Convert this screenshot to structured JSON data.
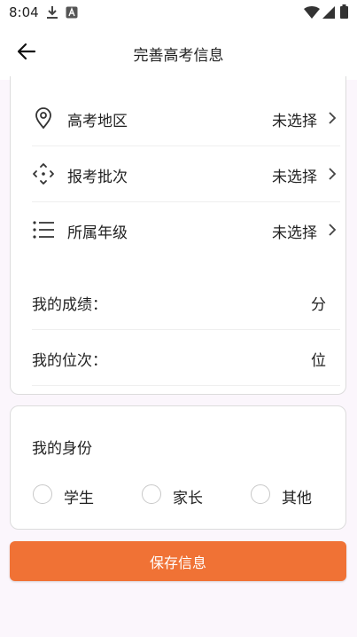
{
  "status_bar": {
    "time": "8:04",
    "left_icons": [
      "download-icon",
      "a-box-icon"
    ],
    "right_icons": [
      "wifi-icon",
      "signal-icon",
      "battery-icon"
    ]
  },
  "header": {
    "title": "完善高考信息",
    "back_icon": "arrow-left-icon"
  },
  "form": {
    "select_rows": [
      {
        "icon": "location-pin-icon",
        "label": "高考地区",
        "value": "未选择"
      },
      {
        "icon": "crosshair-dashed-icon",
        "label": "报考批次",
        "value": "未选择"
      },
      {
        "icon": "list-icon",
        "label": "所属年级",
        "value": "未选择"
      }
    ],
    "score": {
      "label": "我的成绩：",
      "value": "",
      "unit": "分"
    },
    "rank": {
      "label": "我的位次：",
      "value": "",
      "unit": "位"
    }
  },
  "identity": {
    "title": "我的身份",
    "options": [
      "学生",
      "家长",
      "其他"
    ],
    "selected": ""
  },
  "save_button": {
    "label": "保存信息"
  },
  "colors": {
    "accent": "#f07235",
    "background": "#fbf6fc",
    "card_border": "#dcdcdc"
  }
}
